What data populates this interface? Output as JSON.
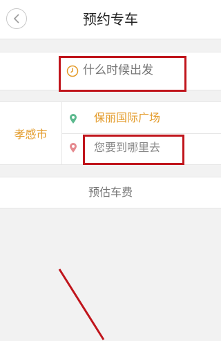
{
  "header": {
    "title": "预约专车"
  },
  "time_row": {
    "placeholder": "什么时候出发"
  },
  "route": {
    "city": "孝感市",
    "from_address": "保丽国际广场",
    "to_placeholder": "您要到哪里去"
  },
  "estimate": {
    "label": "预估车费"
  },
  "colors": {
    "accent_orange": "#e39a28",
    "pin_start_green": "#5cb98e",
    "pin_end_pink": "#e58a8f",
    "highlight_red": "#c0151c"
  },
  "icons": [
    "back-arrow-icon",
    "clock-icon",
    "start-pin-icon",
    "end-pin-icon"
  ]
}
